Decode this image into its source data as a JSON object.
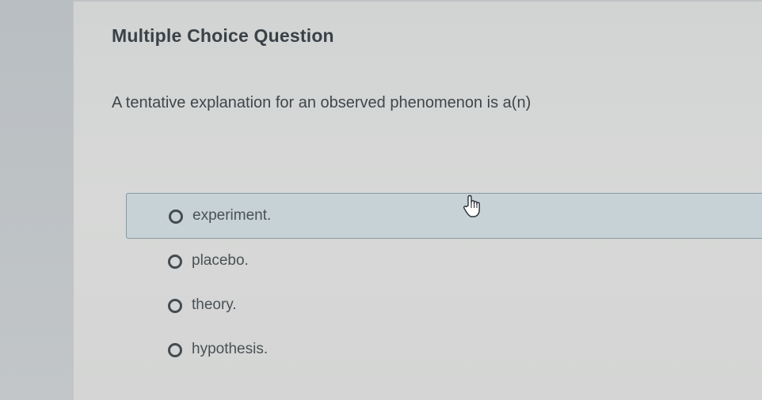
{
  "question_card": {
    "title": "Multiple Choice Question",
    "prompt": "A tentative explanation for an observed phenomenon is a(n)"
  },
  "options": [
    {
      "label": "experiment.",
      "state": "hovered"
    },
    {
      "label": "placebo.",
      "state": "default"
    },
    {
      "label": "theory.",
      "state": "default"
    },
    {
      "label": "hypothesis.",
      "state": "default"
    }
  ],
  "cursor": {
    "icon": "hand-pointer-icon"
  },
  "colors": {
    "background": "#d4d5d4",
    "hover_fill": "#c6d2d6",
    "hover_border": "#8a9aa2",
    "text": "#3f464b"
  }
}
